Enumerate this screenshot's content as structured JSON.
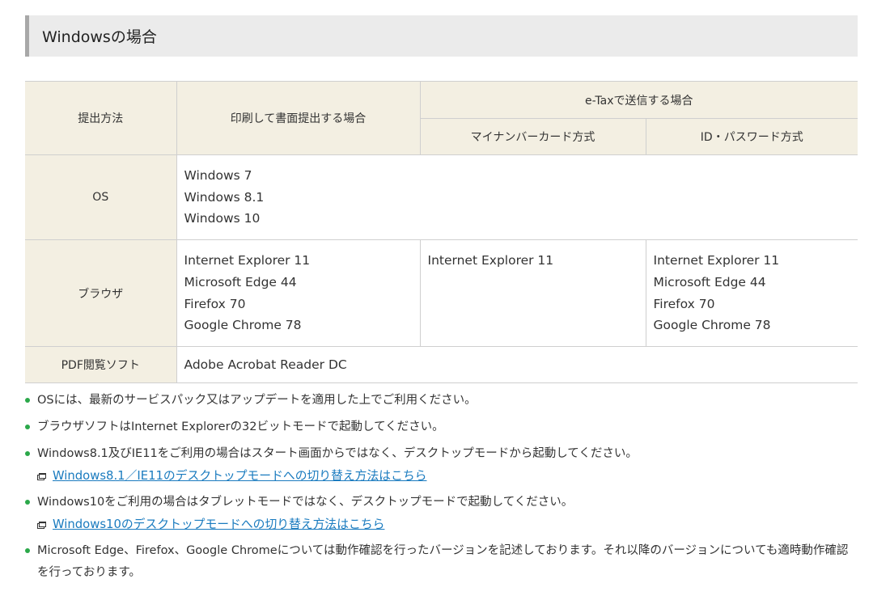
{
  "section_title": "Windowsの場合",
  "table": {
    "header": {
      "method_label": "提出方法",
      "print_label": "印刷して書面提出する場合",
      "etax_label": "e-Taxで送信する場合",
      "mynumber_label": "マイナンバーカード方式",
      "idpass_label": "ID・パスワード方式"
    },
    "rows": {
      "os": {
        "label": "OS",
        "values": [
          "Windows 7",
          "Windows 8.1",
          "Windows 10"
        ]
      },
      "browser": {
        "label": "ブラウザ",
        "print": [
          "Internet Explorer 11",
          "Microsoft Edge 44",
          "Firefox 70",
          "Google Chrome 78"
        ],
        "mynumber": [
          "Internet Explorer 11"
        ],
        "idpass": [
          "Internet Explorer 11",
          "Microsoft Edge 44",
          "Firefox 70",
          "Google Chrome 78"
        ]
      },
      "pdf": {
        "label": "PDF閲覧ソフト",
        "value": "Adobe Acrobat Reader DC"
      }
    }
  },
  "notes": [
    {
      "text": "OSには、最新のサービスパック又はアップデートを適用した上でご利用ください。"
    },
    {
      "text": "ブラウザソフトはInternet Explorerの32ビットモードで起動してください。"
    },
    {
      "text": "Windows8.1及びIE11をご利用の場合はスタート画面からではなく、デスクトップモードから起動してください。",
      "link": "Windows8.1／IE11のデスクトップモードへの切り替え方法はこちら"
    },
    {
      "text": "Windows10をご利用の場合はタブレットモードではなく、デスクトップモードで起動してください。",
      "link": "Windows10のデスクトップモードへの切り替え方法はこちら"
    },
    {
      "text": "Microsoft Edge、Firefox、Google Chromeについては動作確認を行ったバージョンを記述しております。それ以降のバージョンについても適時動作確認を行っております。"
    }
  ],
  "colors": {
    "header_bg": "#f3efe2",
    "title_bg": "#ebebeb",
    "bullet": "#2ba84a",
    "link": "#1a7bbf"
  },
  "icons": {
    "link_icon": "new-window-icon",
    "bullet_icon": "bullet-dot-icon"
  }
}
